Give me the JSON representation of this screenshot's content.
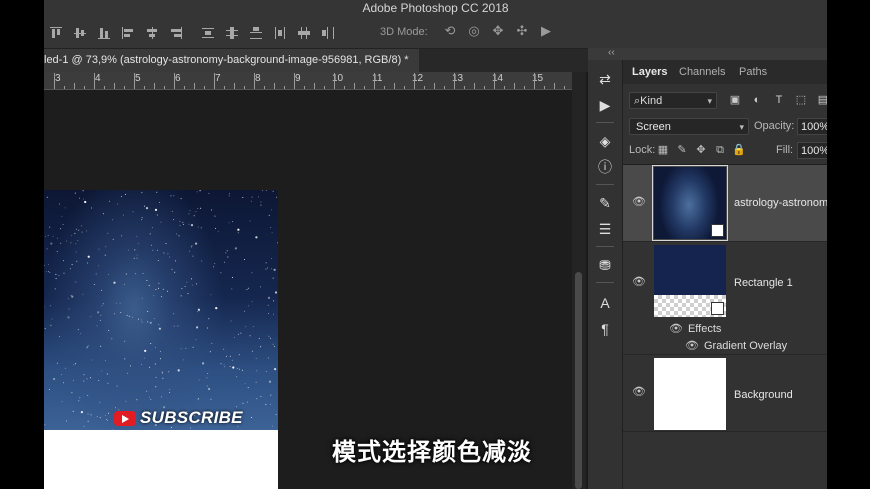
{
  "app": {
    "title": "Adobe Photoshop CC 2018"
  },
  "options_bar": {
    "mode_3d_label": "3D Mode:"
  },
  "document": {
    "tab_title": "led-1 @ 73,9% (astrology-astronomy-background-image-956981, RGB/8) *",
    "close_glyph": "×"
  },
  "ruler": {
    "labels": [
      "3",
      "4",
      "5",
      "6",
      "7",
      "8",
      "9",
      "10",
      "11",
      "12",
      "13",
      "14",
      "15"
    ]
  },
  "canvas": {
    "subscribe_label": "SUBSCRIBE",
    "caption": "模式选择颜色减淡"
  },
  "panel": {
    "collapse_glyph": "‹‹",
    "tabs": [
      "Layers",
      "Channels",
      "Paths"
    ],
    "kind_label": "Kind",
    "kind_icon": "⌕",
    "blend_mode": "Screen",
    "opacity_label": "Opacity:",
    "opacity_value": "100%",
    "lock_label": "Lock:",
    "fill_label": "Fill:",
    "fill_value": "100%"
  },
  "layers": [
    {
      "name": "astrology-astronom",
      "selected": true
    },
    {
      "name": "Rectangle 1",
      "effects_label": "Effects",
      "effect": "Gradient Overlay"
    },
    {
      "name": "Background"
    }
  ],
  "icons": {
    "eye": "👁",
    "chevron": "▾"
  }
}
